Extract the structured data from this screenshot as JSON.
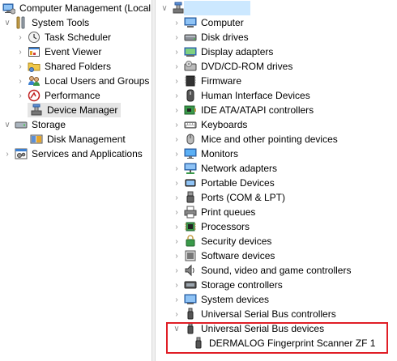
{
  "left_tree": {
    "root_label": "Computer Management (Local",
    "system_tools_label": "System Tools",
    "task_scheduler_label": "Task Scheduler",
    "event_viewer_label": "Event Viewer",
    "shared_folders_label": "Shared Folders",
    "local_users_label": "Local Users and Groups",
    "performance_label": "Performance",
    "device_manager_label": "Device Manager",
    "storage_label": "Storage",
    "disk_management_label": "Disk Management",
    "services_label": "Services and Applications"
  },
  "right_tree": {
    "categories": [
      {
        "label": "Computer",
        "icon": "computer-icon"
      },
      {
        "label": "Disk drives",
        "icon": "disk-drive-icon"
      },
      {
        "label": "Display adapters",
        "icon": "display-adapter-icon"
      },
      {
        "label": "DVD/CD-ROM drives",
        "icon": "dvd-icon"
      },
      {
        "label": "Firmware",
        "icon": "firmware-icon"
      },
      {
        "label": "Human Interface Devices",
        "icon": "hid-icon"
      },
      {
        "label": "IDE ATA/ATAPI controllers",
        "icon": "ide-controller-icon"
      },
      {
        "label": "Keyboards",
        "icon": "keyboard-icon"
      },
      {
        "label": "Mice and other pointing devices",
        "icon": "mouse-icon"
      },
      {
        "label": "Monitors",
        "icon": "monitor-icon"
      },
      {
        "label": "Network adapters",
        "icon": "network-adapter-icon"
      },
      {
        "label": "Portable Devices",
        "icon": "portable-device-icon"
      },
      {
        "label": "Ports (COM & LPT)",
        "icon": "port-icon"
      },
      {
        "label": "Print queues",
        "icon": "printer-icon"
      },
      {
        "label": "Processors",
        "icon": "processor-icon"
      },
      {
        "label": "Security devices",
        "icon": "security-device-icon"
      },
      {
        "label": "Software devices",
        "icon": "software-device-icon"
      },
      {
        "label": "Sound, video and game controllers",
        "icon": "sound-icon"
      },
      {
        "label": "Storage controllers",
        "icon": "storage-controller-icon"
      },
      {
        "label": "System devices",
        "icon": "system-device-icon"
      },
      {
        "label": "Universal Serial Bus controllers",
        "icon": "usb-icon"
      },
      {
        "label": "Universal Serial Bus devices",
        "icon": "usb-icon"
      }
    ],
    "usb_child_label": "DERMALOG Fingerprint Scanner ZF 1"
  },
  "colors": {
    "highlight_border": "#e01e26",
    "selection": "#cce8ff"
  }
}
